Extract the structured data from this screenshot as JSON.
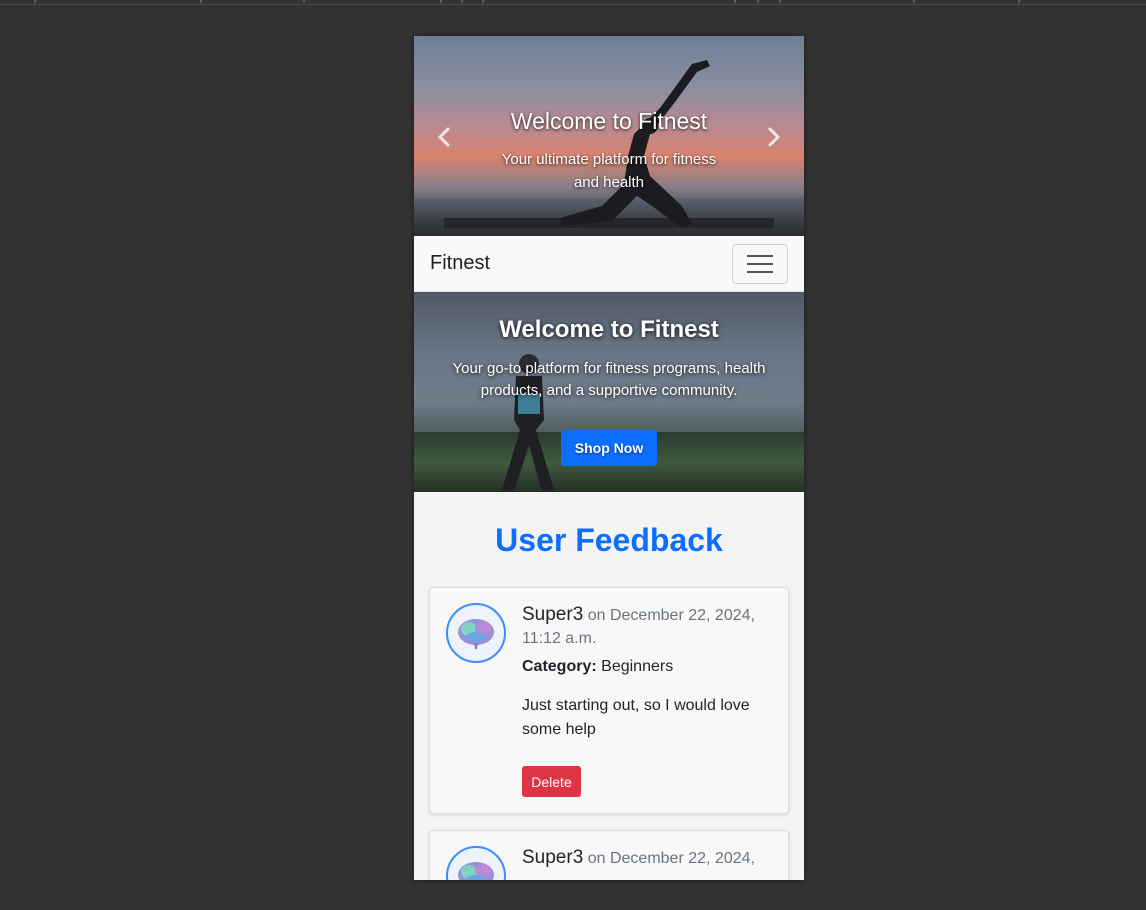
{
  "carousel": {
    "title": "Welcome to Fitnest",
    "subtitle": "Your ultimate platform for fitness and health",
    "prev_icon": "chevron-left-icon",
    "next_icon": "chevron-right-icon"
  },
  "navbar": {
    "brand": "Fitnest",
    "toggler_icon": "hamburger-icon"
  },
  "hero": {
    "title": "Welcome to Fitnest",
    "subtitle": "Your go-to platform for fitness programs, health products, and a supportive community.",
    "cta_label": "Shop Now"
  },
  "feedback": {
    "heading": "User Feedback",
    "items": [
      {
        "username": "Super3",
        "date": "on December 22, 2024, 11:12 a.m.",
        "category_label": "Category:",
        "category": "Beginners",
        "comment": "Just starting out, so I would love some help",
        "delete_label": "Delete"
      },
      {
        "username": "Super3",
        "date": "on December 22, 2024,"
      }
    ]
  },
  "colors": {
    "accent": "#0d6efd",
    "danger": "#dc3545",
    "page_background": "#333333"
  }
}
